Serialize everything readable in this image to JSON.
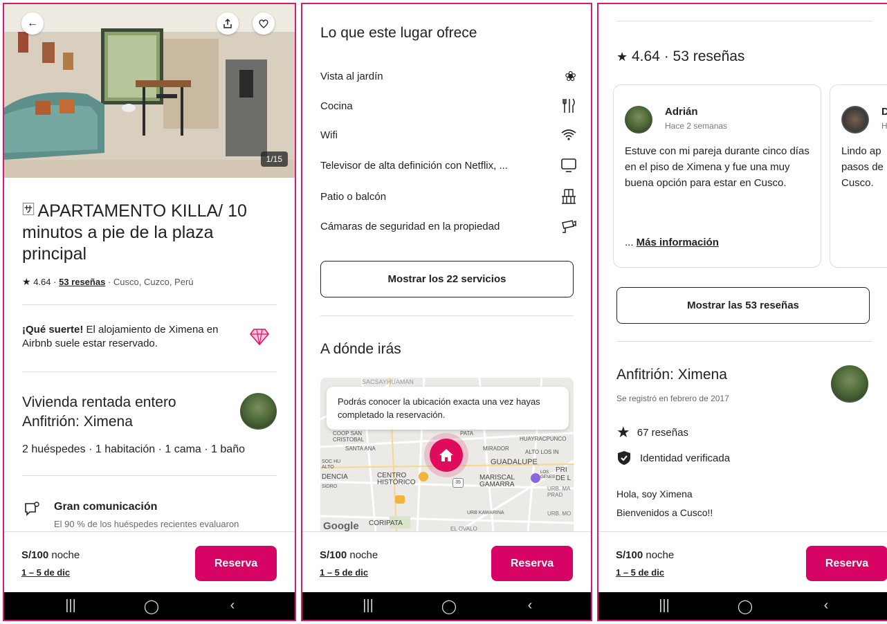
{
  "panel1": {
    "photo_counter": "1/15",
    "listing_title": "APARTAMENTO KILLA/ 10 minutos a pie de la plaza principal",
    "rating": "4.64",
    "rating_sep": "·",
    "reviews_link": "53 reseñas",
    "location": "· Cusco, Cuzco, Perú",
    "luck_bold": "¡Qué suerte!",
    "luck_text": " El alojamiento de Ximena en Airbnb suele estar reservado.",
    "host_title_1": "Vivienda rentada entero",
    "host_title_2": "Anfitrión: Ximena",
    "details": "2 huéspedes · 1 habitación · 1 cama · 1 baño",
    "highlight_title": "Gran comunicación",
    "highlight_text": "El 90 % de los huéspedes recientes evaluaron"
  },
  "panel2": {
    "amenities_title": "Lo que este lugar ofrece",
    "amenities": [
      {
        "label": "Vista al jardín",
        "icon": "✿"
      },
      {
        "label": "Cocina",
        "icon": "🍴"
      },
      {
        "label": "Wifi",
        "icon": "wifi"
      },
      {
        "label": "Televisor de alta definición con Netflix, ...",
        "icon": "tv"
      },
      {
        "label": "Patio o balcón",
        "icon": "balcony"
      },
      {
        "label": "Cámaras de seguridad en la propiedad",
        "icon": "camera"
      }
    ],
    "show_services_button": "Mostrar los 22 servicios",
    "where_title": "A dónde irás",
    "map_tooltip": "Podrás conocer la ubicación exacta una vez hayas completado la reservación.",
    "map_labels": {
      "sacsayhuaman": "SACSAYHUAMAN",
      "coop": "COOP SAN CRISTOBAL",
      "santa_ana": "SANTA ANA",
      "mirador": "MIRADOR",
      "alto_los": "ALTO LOS IN",
      "huayracpunco": "HUAYRACPUNCO",
      "guadalupe": "GUADALUPE",
      "centro": "CENTRO HISTÓRICO",
      "mariscal": "MARISCAL GAMARRA",
      "kawarina": "URB KAWARINA",
      "coripata": "CORIPATA",
      "dencia": "DENCIA",
      "soc": "SOC HU ALTO",
      "sidro": "SIDRO",
      "pata": "PATA",
      "urb_ma": "URB. MA PRAD",
      "urb_mo": "URB. MO",
      "ovalo": "EL OVALO",
      "pri": "PRI",
      "de": "DE L",
      "los_genes": "LOS GENES",
      "road35": "35",
      "google": "Google"
    }
  },
  "panel3": {
    "rating_header": "4.64 · 53 reseñas",
    "review1_name": "Adrián",
    "review1_date": "Hace 2 semanas",
    "review1_text": "Estuve con mi pareja durante cinco días en el piso de Ximena y fue una muy buena opción para estar en Cusco.",
    "review1_more_prefix": "... ",
    "review1_more": "Más información",
    "review2_initial": "D",
    "review2_date_initial": "H",
    "review2_text": "Lindo ap pasos de Cusco.",
    "show_reviews_button": "Mostrar las 53 reseñas",
    "host_title": "Anfitrión: Ximena",
    "host_since": "Se registró en febrero de 2017",
    "host_reviews": "67 reseñas",
    "host_verified": "Identidad verificada",
    "host_greeting_1": "Hola, soy Ximena",
    "host_greeting_2": "Bienvenidos a Cusco!!"
  },
  "booking": {
    "price": "S/100",
    "price_unit": " noche",
    "dates": "1 – 5 de dic",
    "reserve_button": "Reserva"
  },
  "colors": {
    "accent": "#d70466",
    "frame": "#d81b72",
    "map_pin": "#e00b5b"
  }
}
